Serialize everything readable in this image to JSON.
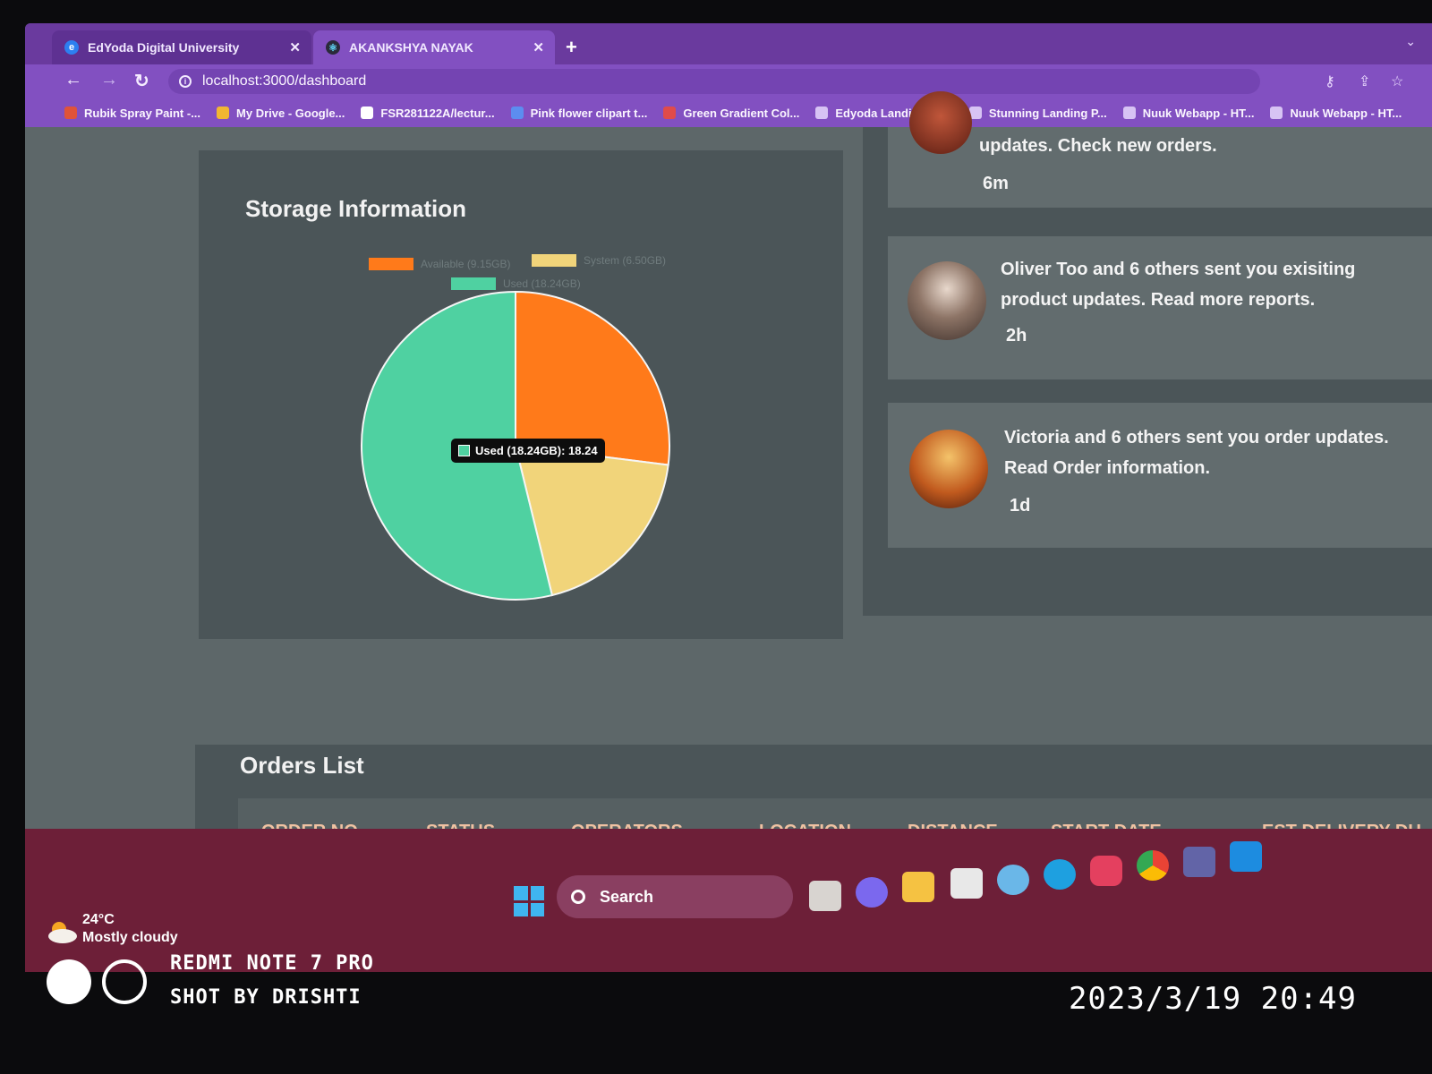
{
  "browser": {
    "tabs": [
      {
        "label": "EdYoda Digital University",
        "icon": "edyoda-icon"
      },
      {
        "label": "AKANKSHYA NAYAK",
        "icon": "react-icon"
      }
    ],
    "tab_close": "✕",
    "new_tab": "+",
    "url": "localhost:3000/dashboard",
    "bookmarks": [
      {
        "label": "Rubik Spray Paint -...",
        "color": "#e0533a"
      },
      {
        "label": "My Drive - Google...",
        "color": "#f2b632"
      },
      {
        "label": "FSR281122A/lectur...",
        "color": "#ffffff"
      },
      {
        "label": "Pink flower clipart t...",
        "color": "#5c8df0"
      },
      {
        "label": "Green Gradient Col...",
        "color": "#e04b4b"
      },
      {
        "label": "Edyoda Landing Pa...",
        "color": "#d7c3f4"
      },
      {
        "label": "Stunning Landing P...",
        "color": "#d7c3f4"
      },
      {
        "label": "Nuuk Webapp - HT...",
        "color": "#d7c3f4"
      },
      {
        "label": "Nuuk Webapp - HT...",
        "color": "#d7c3f4"
      }
    ]
  },
  "storage": {
    "title": "Storage Information",
    "tooltip": "Used (18.24GB): 18.24"
  },
  "chart_data": {
    "type": "pie",
    "title": "Storage Information",
    "categories": [
      "Available (9.15GB)",
      "System (6.50GB)",
      "Used (18.24GB)"
    ],
    "values": [
      9.15,
      6.5,
      18.24
    ],
    "colors": [
      "#ff7a1a",
      "#f1d47a",
      "#4fd1a1"
    ],
    "legend_position": "top"
  },
  "notifications": [
    {
      "text": "updates. Check new orders.",
      "time": "6m"
    },
    {
      "text": "Oliver Too and 6 others sent you exisiting product updates. Read more reports.",
      "time": "2h"
    },
    {
      "text": "Victoria and 6 others sent you order updates. Read Order information.",
      "time": "1d"
    }
  ],
  "orders": {
    "title": "Orders List",
    "columns": [
      "ORDER NO.",
      "STATUS",
      "OPERATORS",
      "LOCATION",
      "DISTANCE",
      "START DATE",
      "EST DELIVERY DU"
    ]
  },
  "taskbar": {
    "weather_temp": "24°C",
    "weather_desc": "Mostly cloudy",
    "search_label": "Search"
  },
  "watermark": {
    "line1": "REDMI NOTE 7 PRO",
    "line2": "SHOT BY DRISHTI",
    "datetime": "2023/3/19 20:49"
  }
}
